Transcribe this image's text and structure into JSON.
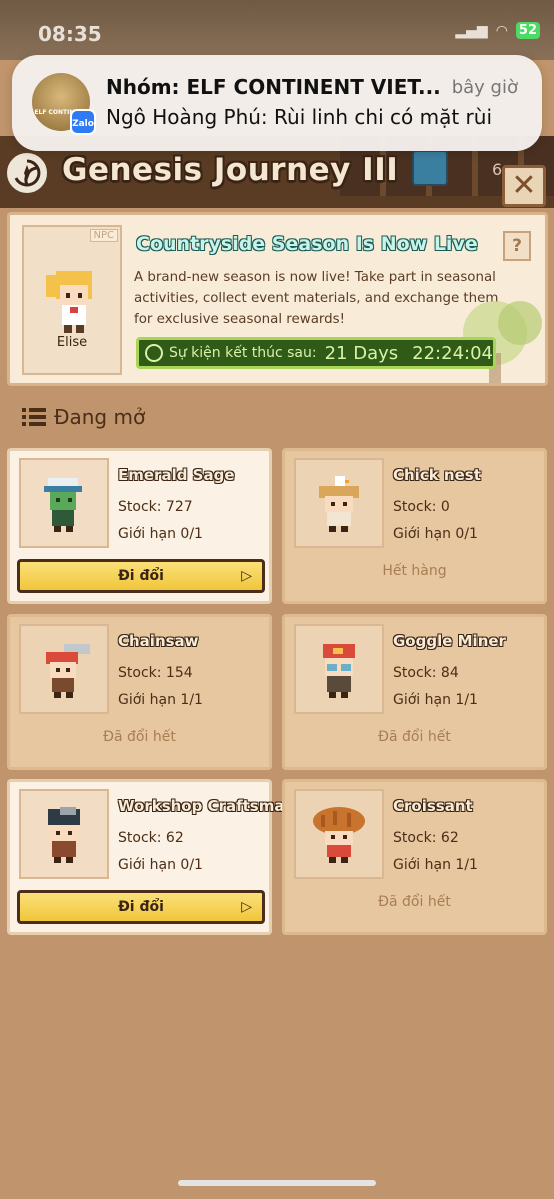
{
  "status_bar": {
    "time": "08:35",
    "battery": "52"
  },
  "notification": {
    "title": "Nhóm: ELF CONTINENT VIET...",
    "time": "bây giờ",
    "body": "Ngô Hoàng Phú: Rùi linh chi có mặt rùi",
    "app_icon": "Zalo",
    "avatar_text": "ELF CONTINENT"
  },
  "header": {
    "title": "Genesis Journey III",
    "count": "6"
  },
  "npc_banner": {
    "tag": "NPC",
    "npc_name": "Elise",
    "title": "Countryside Season Is Now Live",
    "description": "A brand-new season is now live! Take part in seasonal activities, collect event materials, and exchange them for exclusive seasonal rewards!",
    "timer_label": "Sự kiện kết thúc sau:",
    "timer_days": "21 Days",
    "timer_clock": "22:24:04"
  },
  "section": {
    "title": "Đang mở"
  },
  "cards": [
    {
      "name": "Emerald Sage",
      "stock": "Stock: 727",
      "limit": "Giới hạn 0/1",
      "action": "Đi đổi"
    },
    {
      "name": "Chick nest",
      "stock": "Stock: 0",
      "limit": "Giới hạn 0/1",
      "status": "Hết hàng"
    },
    {
      "name": "Chainsaw",
      "stock": "Stock: 154",
      "limit": "Giới hạn 1/1",
      "status": "Đã đổi hết"
    },
    {
      "name": "Goggle Miner",
      "stock": "Stock: 84",
      "limit": "Giới hạn 1/1",
      "status": "Đã đổi hết"
    },
    {
      "name": "Workshop Craftsman",
      "stock": "Stock: 62",
      "limit": "Giới hạn 0/1",
      "action": "Đi đổi"
    },
    {
      "name": "Croissant",
      "stock": "Stock: 62",
      "limit": "Giới hạn 1/1",
      "status": "Đã đổi hết"
    }
  ],
  "icons": {
    "close": "close-icon",
    "help": "help-icon",
    "timer": "clock-icon",
    "list": "list-icon"
  },
  "colors": {
    "background": "#c0946c",
    "card_active": "#fbf1e4",
    "card_inactive": "#e7c7a0",
    "action_button": "#f0c63a",
    "timer_bg": "#2f5a18",
    "event_title": "#c7f4ea"
  }
}
